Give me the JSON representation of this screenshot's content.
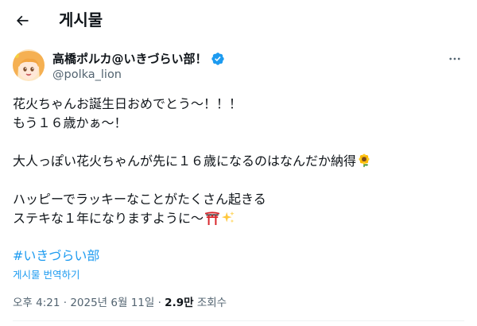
{
  "header": {
    "title": "게시물"
  },
  "author": {
    "name": "高橋ポルカ@いきづらい部！",
    "handle": "@polka_lion"
  },
  "tweet": {
    "lines": [
      "花火ちゃんお誕生日おめでとう〜！！！",
      "もう１６歳かぁ〜！",
      "",
      "大人っぽい花火ちゃんが先に１６歳になるのはなんだか納得",
      "",
      "ハッピーでラッキーなことがたくさん起きる",
      "ステキな１年になりますように〜"
    ],
    "hashtag": "#いきづらい部",
    "translate_label": "게시물 번역하기"
  },
  "meta": {
    "time": "오후 4:21",
    "date": "2025년 6월 11일",
    "views_count": "2.9만",
    "views_label": "조회수"
  },
  "icons": {
    "back": "arrow-left-icon",
    "verified": "verified-badge-icon",
    "more": "more-horizontal-icon",
    "sunflower": "sunflower-emoji",
    "torii": "torii-gate-emoji",
    "sparkles": "sparkles-emoji"
  },
  "colors": {
    "accent": "#1d9bf0",
    "text_primary": "#0f1419",
    "text_secondary": "#536471"
  }
}
